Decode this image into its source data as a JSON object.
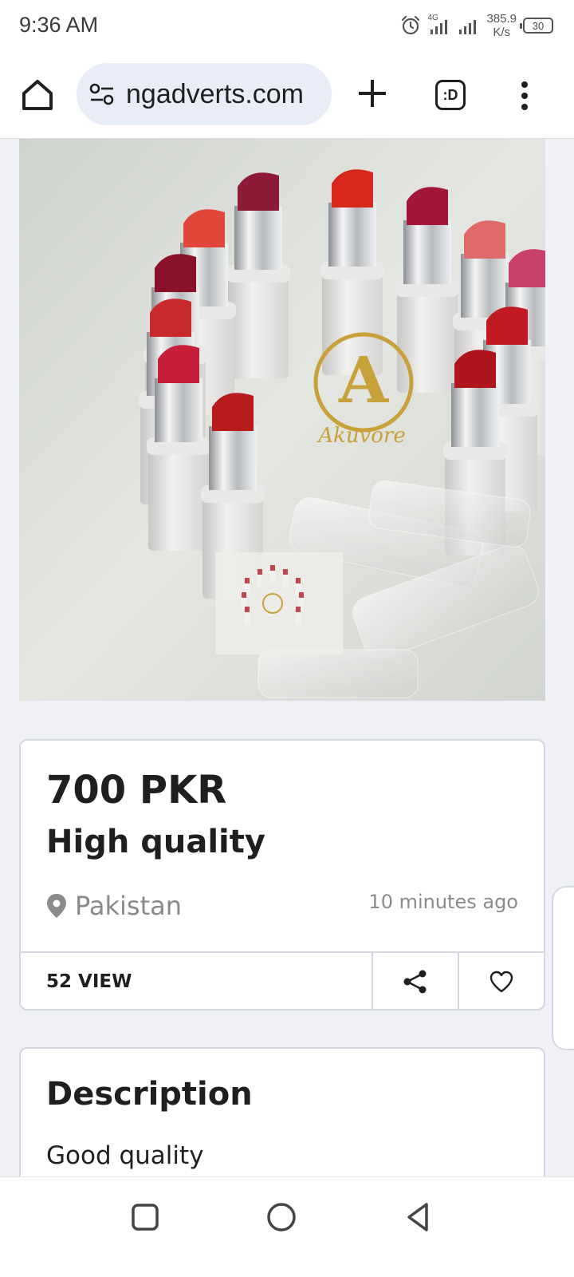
{
  "status_bar": {
    "time": "9:36 AM",
    "network_label": "4G",
    "net_speed_value": "385.9",
    "net_speed_unit": "K/s",
    "battery": "30"
  },
  "browser": {
    "url": "ngadverts.com",
    "tabs_label": ":D",
    "icons": [
      "home-icon",
      "site-settings-icon",
      "plus-icon",
      "tabs-icon",
      "more-vertical-icon"
    ]
  },
  "listing": {
    "image_alt": "Lipsticks arranged in a circle",
    "price": "700 PKR",
    "title": "High quality",
    "location": "Pakistan",
    "posted": "10 minutes ago",
    "views": "52 VIEW"
  },
  "description": {
    "heading": "Description",
    "text": "Good quality"
  },
  "colors": {
    "page_bg": "#eff1f6",
    "url_pill": "#e8edf8",
    "muted_text": "#8a8a8a",
    "border": "#d4d7de"
  }
}
